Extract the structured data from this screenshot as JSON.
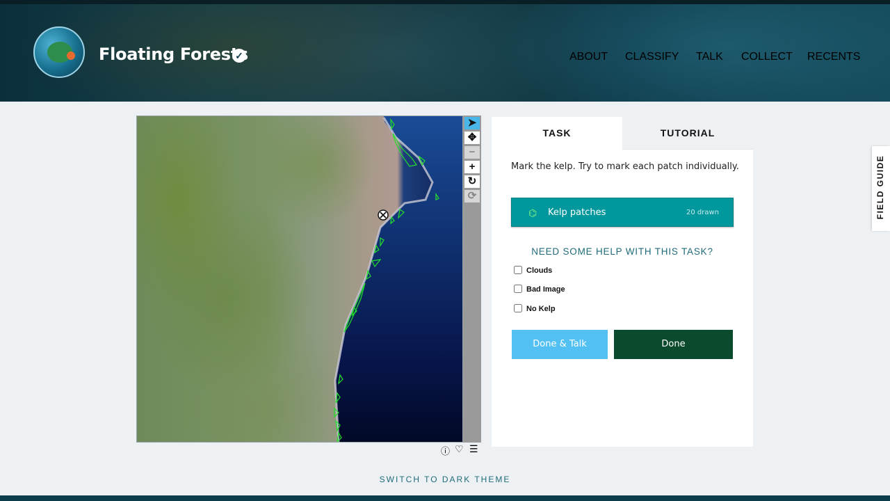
{
  "header": {
    "project_title": "Floating Forests",
    "verified_icon": "check-circle-icon",
    "nav": [
      {
        "label": "ABOUT",
        "active": false
      },
      {
        "label": "CLASSIFY",
        "active": true
      },
      {
        "label": "TALK",
        "active": false
      },
      {
        "label": "COLLECT",
        "active": false
      },
      {
        "label": "RECENTS",
        "active": false
      }
    ]
  },
  "viewer": {
    "tools": [
      "pointer-icon",
      "move-icon",
      "zoom-out-icon",
      "zoom-in-icon",
      "rotate-icon",
      "reset-icon"
    ],
    "bottom_icons": [
      "info-icon",
      "heart-icon",
      "list-icon"
    ],
    "accent": "#4ab5e8"
  },
  "task_panel": {
    "tabs": {
      "task": "TASK",
      "tutorial": "TUTORIAL"
    },
    "instructions": "Mark the kelp. Try to mark each patch individually.",
    "tool": {
      "label": "Kelp patches",
      "count": "20 drawn",
      "color": "#00979d"
    },
    "help": "NEED SOME HELP WITH THIS TASK?",
    "checkboxes": [
      {
        "label": "Clouds",
        "checked": false
      },
      {
        "label": "Bad Image",
        "checked": false
      },
      {
        "label": "No Kelp",
        "checked": false
      }
    ],
    "done_talk": "Done & Talk",
    "done": "Done"
  },
  "field_guide": "FIELD GUIDE",
  "footer": {
    "theme_toggle": "SWITCH TO DARK THEME"
  }
}
